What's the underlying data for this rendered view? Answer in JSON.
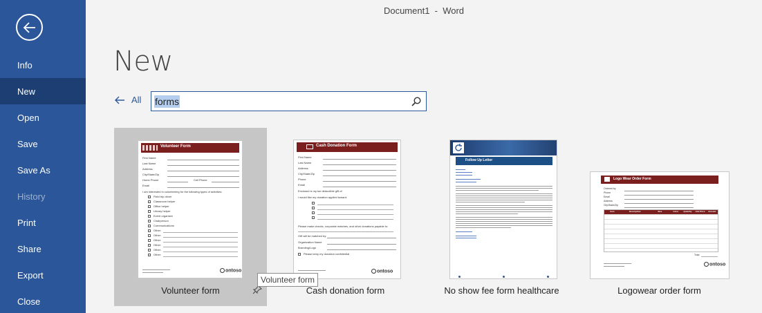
{
  "window": {
    "title": "Document1  -  Word"
  },
  "sidebar": {
    "items": [
      {
        "label": "Info",
        "state": "normal"
      },
      {
        "label": "New",
        "state": "active"
      },
      {
        "label": "Open",
        "state": "normal"
      },
      {
        "label": "Save",
        "state": "normal"
      },
      {
        "label": "Save As",
        "state": "normal"
      },
      {
        "label": "History",
        "state": "disabled"
      },
      {
        "label": "Print",
        "state": "normal"
      },
      {
        "label": "Share",
        "state": "normal"
      },
      {
        "label": "Export",
        "state": "normal"
      },
      {
        "label": "Close",
        "state": "normal"
      }
    ]
  },
  "main": {
    "title": "New",
    "back_label": "All",
    "search": {
      "value": "forms"
    }
  },
  "templates": [
    {
      "label": "Volunteer form",
      "header": "Volunteer Form",
      "fields": [
        "First Name",
        "Last Name",
        "Address",
        "City/State/Zip",
        "Home Phone",
        "Cell Phone",
        "Email"
      ],
      "intro": "I am interested in volunteering for the following types of activities:",
      "activities": [
        "Field trip driver",
        "Classroom helper",
        "Office helper",
        "Library helper",
        "Event organizer",
        "Chairperson",
        "Communications",
        "Other:",
        "Other:",
        "Other:",
        "Other:",
        "Other:",
        "Other:"
      ],
      "logo": "ontoso"
    },
    {
      "label": "Cash donation form",
      "header": "Cash Donation Form",
      "fields": [
        "First Name",
        "Last Name",
        "Address",
        "City/State/Zip",
        "Phone",
        "Email",
        "Enclosed is my tax deductible gift of",
        "I would like my donation applied toward:"
      ],
      "notes": [
        "Please make checks, corporate matches, and other donations payable to:",
        "Gift will be matched by:",
        "Organization Name",
        "Branding/Logo",
        "Please keep my donation confidential"
      ],
      "logo": "ontoso"
    },
    {
      "label": "No show fee form healthcare",
      "header": "Follow Up Letter"
    },
    {
      "label": "Logowear order form",
      "header": "Logo Wear Order Form",
      "fields": [
        "Ordered by",
        "Phone",
        "Email",
        "Address",
        "City/State/Zip"
      ],
      "columns": [
        "Item",
        "Description",
        "Size",
        "Color",
        "Quantity",
        "Unit Price",
        "Amount"
      ],
      "total_label": "Total",
      "logo": "ontoso"
    }
  ],
  "tooltip": {
    "text": "Volunteer form"
  }
}
